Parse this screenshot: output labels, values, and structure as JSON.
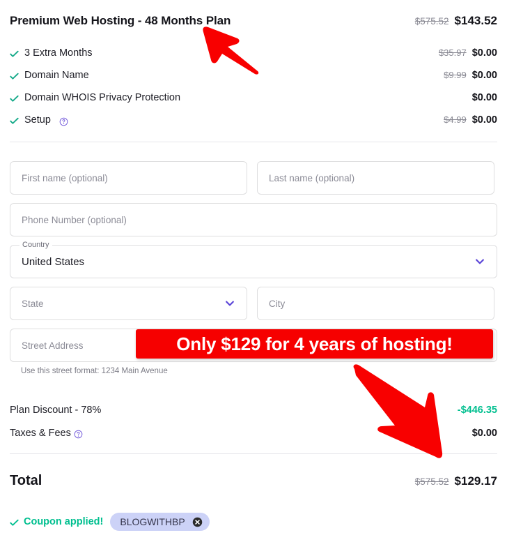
{
  "plan": {
    "title": "Premium Web Hosting - 48 Months Plan",
    "price_old": "$575.52",
    "price_new": "$143.52"
  },
  "features": [
    {
      "check_icon": "check-icon",
      "label": "3 Extra Months",
      "price_old": "$35.97",
      "price_new": "$0.00",
      "has_help": false
    },
    {
      "check_icon": "check-icon",
      "label": "Domain Name",
      "price_old": "$9.99",
      "price_new": "$0.00",
      "has_help": false
    },
    {
      "check_icon": "check-icon",
      "label": "Domain WHOIS Privacy Protection",
      "price_old": "",
      "price_new": "$0.00",
      "has_help": false
    },
    {
      "check_icon": "check-icon",
      "label": "Setup",
      "price_old": "$4.99",
      "price_new": "$0.00",
      "has_help": true
    }
  ],
  "form": {
    "first_name_placeholder": "First name (optional)",
    "last_name_placeholder": "Last name (optional)",
    "phone_placeholder": "Phone Number (optional)",
    "country_label": "Country",
    "country_value": "United States",
    "state_placeholder": "State",
    "city_placeholder": "City",
    "street_placeholder": "Street Address",
    "street_helper": "Use this street format: 1234 Main Avenue"
  },
  "summary": {
    "discount_label": "Plan Discount - 78%",
    "discount_value": "-$446.35",
    "taxes_label": "Taxes & Fees",
    "taxes_value": "$0.00"
  },
  "total": {
    "label": "Total",
    "price_old": "$575.52",
    "price_new": "$129.17"
  },
  "coupon": {
    "applied_text": "Coupon applied!",
    "code": "BLOGWITHBP",
    "remove_icon": "close-circle-icon"
  },
  "annotations": {
    "banner_text": "Only $129 for 4 years of hosting!",
    "arrow_top": "red-arrow-up-left-icon",
    "arrow_bottom": "red-arrow-down-right-icon"
  },
  "colors": {
    "accent_teal": "#00bf8f",
    "accent_purple": "#5b45d8",
    "annotation_red": "#f60000",
    "chip_bg": "#ccd2f7",
    "text_dark": "#14141a",
    "text_muted": "#8b8b96"
  }
}
